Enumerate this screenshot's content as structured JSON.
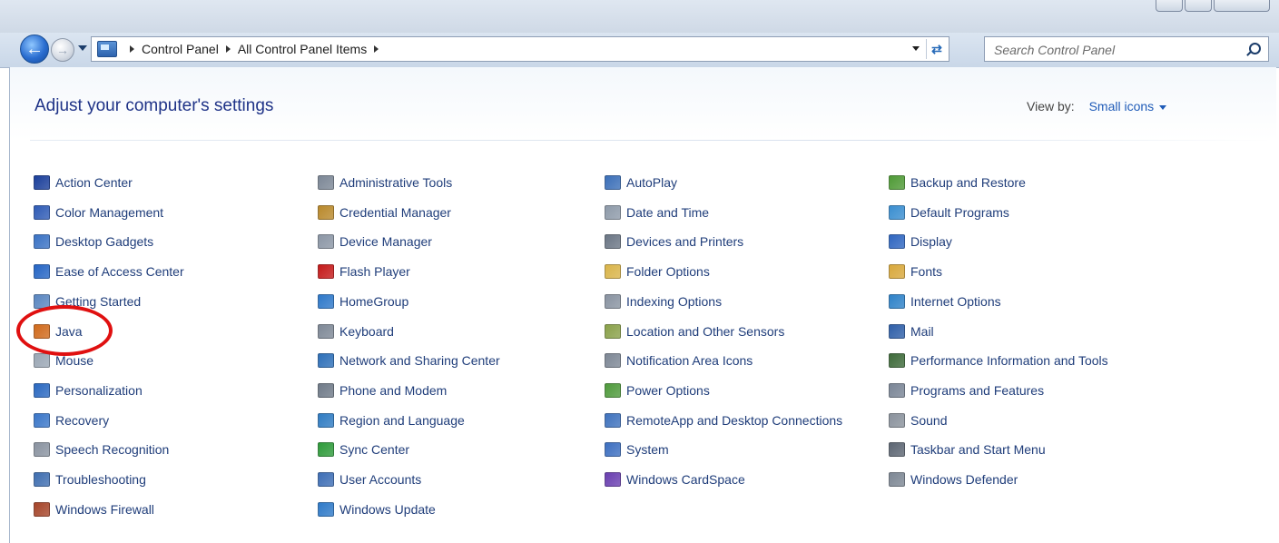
{
  "navigation": {
    "breadcrumb": [
      "Control Panel",
      "All Control Panel Items"
    ],
    "search_placeholder": "Search Control Panel"
  },
  "header": {
    "title": "Adjust your computer's settings",
    "view_by_label": "View by:",
    "view_by_value": "Small icons"
  },
  "columns": [
    [
      {
        "label": "Action Center",
        "icon": "flag-icon",
        "color": "#1b3f9a"
      },
      {
        "label": "Color Management",
        "icon": "monitor-color-icon",
        "color": "#2f5bb5"
      },
      {
        "label": "Desktop Gadgets",
        "icon": "gadgets-icon",
        "color": "#3a72c4"
      },
      {
        "label": "Ease of Access Center",
        "icon": "ease-of-access-icon",
        "color": "#2565c4"
      },
      {
        "label": "Getting Started",
        "icon": "getting-started-icon",
        "color": "#5a86c0"
      },
      {
        "label": "Java",
        "icon": "java-icon",
        "color": "#d06a1c"
      },
      {
        "label": "Mouse",
        "icon": "mouse-icon",
        "color": "#9aa6b4"
      },
      {
        "label": "Personalization",
        "icon": "personalization-icon",
        "color": "#2a68c0"
      },
      {
        "label": "Recovery",
        "icon": "recovery-icon",
        "color": "#3a76c8"
      },
      {
        "label": "Speech Recognition",
        "icon": "microphone-icon",
        "color": "#8a93a0"
      },
      {
        "label": "Troubleshooting",
        "icon": "troubleshooting-icon",
        "color": "#3f6eb0"
      },
      {
        "label": "Windows Firewall",
        "icon": "firewall-icon",
        "color": "#a5452a"
      }
    ],
    [
      {
        "label": "Administrative Tools",
        "icon": "admin-tools-icon",
        "color": "#7c8796"
      },
      {
        "label": "Credential Manager",
        "icon": "credential-icon",
        "color": "#b9892c"
      },
      {
        "label": "Device Manager",
        "icon": "device-manager-icon",
        "color": "#8b96a5"
      },
      {
        "label": "Flash Player",
        "icon": "flash-icon",
        "color": "#c41a1a"
      },
      {
        "label": "HomeGroup",
        "icon": "homegroup-icon",
        "color": "#2e78c9"
      },
      {
        "label": "Keyboard",
        "icon": "keyboard-icon",
        "color": "#7e8896"
      },
      {
        "label": "Network and Sharing Center",
        "icon": "network-icon",
        "color": "#2d6fb8"
      },
      {
        "label": "Phone and Modem",
        "icon": "phone-icon",
        "color": "#6f7a88"
      },
      {
        "label": "Region and Language",
        "icon": "globe-icon",
        "color": "#2f7bc2"
      },
      {
        "label": "Sync Center",
        "icon": "sync-icon",
        "color": "#2e9a3a"
      },
      {
        "label": "User Accounts",
        "icon": "user-accounts-icon",
        "color": "#3e6eb5"
      },
      {
        "label": "Windows Update",
        "icon": "windows-update-icon",
        "color": "#2f7ac8"
      }
    ],
    [
      {
        "label": "AutoPlay",
        "icon": "autoplay-icon",
        "color": "#3b6fb8"
      },
      {
        "label": "Date and Time",
        "icon": "clock-icon",
        "color": "#8e9aa9"
      },
      {
        "label": "Devices and Printers",
        "icon": "printer-icon",
        "color": "#6b7685"
      },
      {
        "label": "Folder Options",
        "icon": "folder-icon",
        "color": "#d9b44a"
      },
      {
        "label": "Indexing Options",
        "icon": "indexing-icon",
        "color": "#8993a1"
      },
      {
        "label": "Location and Other Sensors",
        "icon": "sensors-icon",
        "color": "#8aa14a"
      },
      {
        "label": "Notification Area Icons",
        "icon": "notification-icon",
        "color": "#7d8795"
      },
      {
        "label": "Power Options",
        "icon": "power-icon",
        "color": "#4f9a3c"
      },
      {
        "label": "RemoteApp and Desktop Connections",
        "icon": "remoteapp-icon",
        "color": "#3f72bd"
      },
      {
        "label": "System",
        "icon": "system-icon",
        "color": "#3d6fc0"
      },
      {
        "label": "Windows CardSpace",
        "icon": "cardspace-icon",
        "color": "#6a3fb0"
      }
    ],
    [
      {
        "label": "Backup and Restore",
        "icon": "backup-icon",
        "color": "#4f9a36"
      },
      {
        "label": "Default Programs",
        "icon": "default-programs-icon",
        "color": "#3a8ed0"
      },
      {
        "label": "Display",
        "icon": "display-icon",
        "color": "#2f66c0"
      },
      {
        "label": "Fonts",
        "icon": "fonts-icon",
        "color": "#d8a83c"
      },
      {
        "label": "Internet Options",
        "icon": "internet-options-icon",
        "color": "#2f82c8"
      },
      {
        "label": "Mail",
        "icon": "mail-icon",
        "color": "#2f5fa8"
      },
      {
        "label": "Performance Information and Tools",
        "icon": "performance-icon",
        "color": "#3e6a3a"
      },
      {
        "label": "Programs and Features",
        "icon": "programs-icon",
        "color": "#7a8596"
      },
      {
        "label": "Sound",
        "icon": "speaker-icon",
        "color": "#8a929c"
      },
      {
        "label": "Taskbar and Start Menu",
        "icon": "taskbar-icon",
        "color": "#5d6673"
      },
      {
        "label": "Windows Defender",
        "icon": "defender-icon",
        "color": "#7d8794"
      }
    ]
  ]
}
